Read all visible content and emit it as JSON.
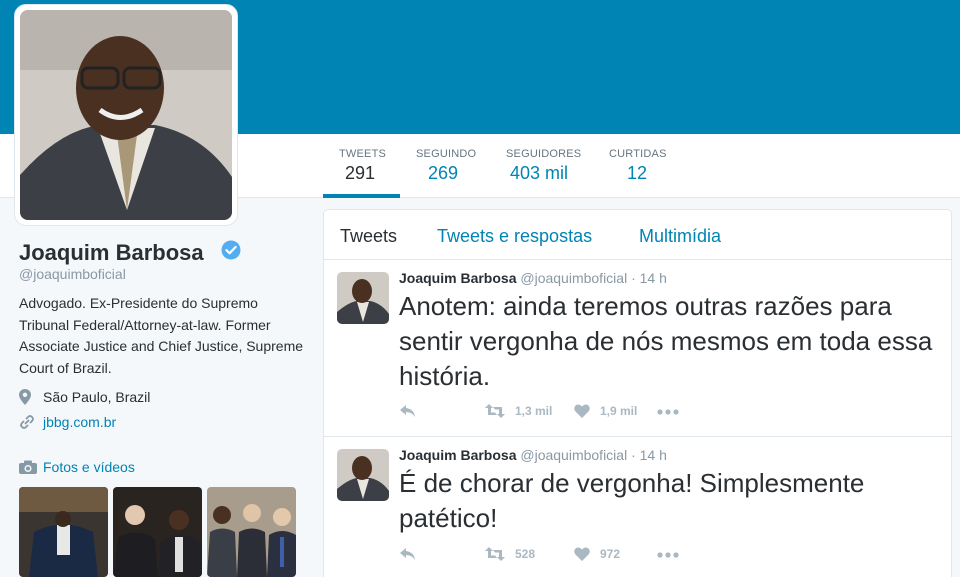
{
  "profile": {
    "name": "Joaquim Barbosa",
    "handle": "@joaquimboficial",
    "bio": "Advogado. Ex-Presidente do Supremo Tribunal Federal/Attorney-at-law. Former Associate Justice and Chief Justice, Supreme Court of Brazil.",
    "location": "São Paulo, Brazil",
    "website": "jbbg.com.br",
    "photos_label": "Fotos e vídeos"
  },
  "stats": [
    {
      "label": "TWEETS",
      "value": "291"
    },
    {
      "label": "SEGUINDO",
      "value": "269"
    },
    {
      "label": "SEGUIDORES",
      "value": "403 mil"
    },
    {
      "label": "CURTIDAS",
      "value": "12"
    }
  ],
  "timeline_tabs": [
    {
      "label": "Tweets"
    },
    {
      "label": "Tweets e respostas"
    },
    {
      "label": "Multimídia"
    }
  ],
  "tweets": [
    {
      "name": "Joaquim Barbosa",
      "handle": "@joaquimboficial",
      "time": "· 14 h",
      "text": "Anotem: ainda teremos outras razões para sentir vergonha de nós mesmos em toda essa história.",
      "retweets": "1,3 mil",
      "likes": "1,9 mil"
    },
    {
      "name": "Joaquim Barbosa",
      "handle": "@joaquimboficial",
      "time": "· 14 h",
      "text": "É de chorar de vergonha! Simplesmente patético!",
      "retweets": "528",
      "likes": "972"
    }
  ],
  "colors": {
    "banner": "#0084b4",
    "link": "#0084b4",
    "muted": "#8899a6",
    "action_icon": "#aab8c2"
  }
}
